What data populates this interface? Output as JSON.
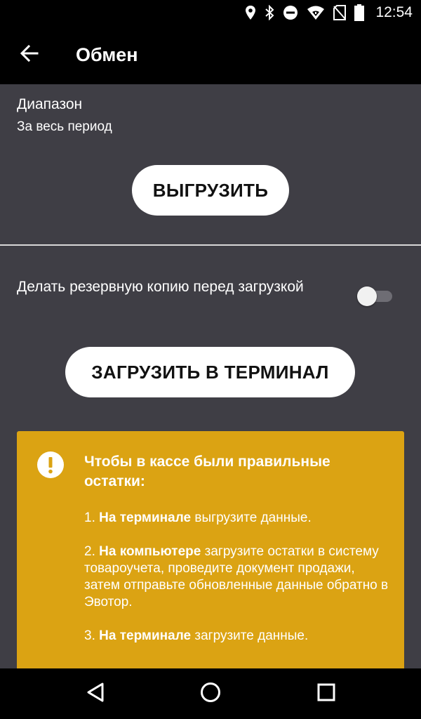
{
  "status_bar": {
    "time": "12:54",
    "icons": [
      "location-icon",
      "bluetooth-icon",
      "do-not-disturb-icon",
      "wifi-icon",
      "no-sim-icon",
      "battery-icon"
    ]
  },
  "toolbar": {
    "title": "Обмен",
    "back_icon": "arrow-left-icon"
  },
  "range": {
    "label": "Диапазон",
    "value": "За весь период"
  },
  "export_button": {
    "label": "ВЫГРУЗИТЬ"
  },
  "backup": {
    "label": "Делать резервную копию перед загрузкой",
    "enabled": false
  },
  "import_button": {
    "label": "ЗАГРУЗИТЬ В ТЕРМИНАЛ"
  },
  "info_card": {
    "icon": "warning-icon",
    "title": "Чтобы в кассе были правильные остатки:",
    "steps": [
      {
        "number": "1.",
        "bold": "На терминале",
        "text": " выгрузите данные."
      },
      {
        "number": "2.",
        "bold": "На компьютере",
        "text": " загрузите остатки в систему товароучета, проведите документ продажи, затем отправьте обновленные данные обратно в Эвотор."
      },
      {
        "number": "3.",
        "bold": "На терминале",
        "text": " загрузите данные."
      }
    ]
  },
  "colors": {
    "background": "#3f3e45",
    "bars": "#000000",
    "card": "#dba313",
    "button": "#ffffff"
  },
  "nav_bar": {
    "icons": [
      "back-triangle-icon",
      "home-circle-icon",
      "recents-square-icon"
    ]
  }
}
